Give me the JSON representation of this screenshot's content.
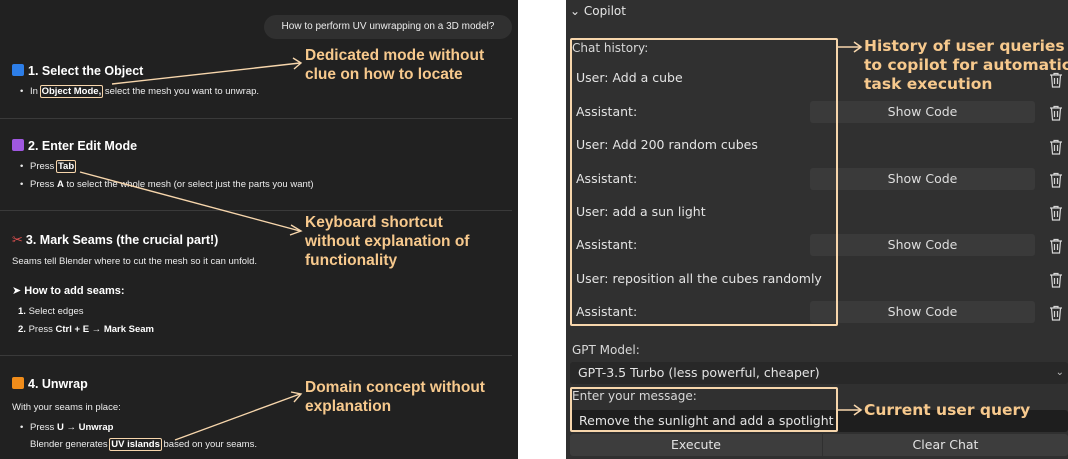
{
  "colors": {
    "annotation": "#f7c98d",
    "highlight_box": "#f7d6ac",
    "left_bg": "#212121",
    "right_bg": "#303030"
  },
  "left": {
    "user_question": "How to perform UV unwrapping on a 3D model?",
    "s1": {
      "icon": "blue-square-icon",
      "title": "1. Select the Object",
      "b1_pre": "In ",
      "b1_hl": "Object Mode,",
      "b1_post": " select the mesh you want to unwrap."
    },
    "s2": {
      "icon": "purple-square-icon",
      "title": "2. Enter Edit Mode",
      "b1_pre": "Press ",
      "b1_hl": "Tab",
      "b2_pre": "Press ",
      "b2_key": "A",
      "b2_post": " to select the whole mesh (or select just the parts you want)"
    },
    "s3": {
      "icon": "scissors-icon",
      "icon_glyph": "✂",
      "title": "3. Mark Seams (the crucial part!)",
      "desc": "Seams tell Blender where to cut the mesh so it can unfold.",
      "how_title": "➤ How to add seams:",
      "n1_num": "1.",
      "n1": "Select edges",
      "n2_num": "2.",
      "n2_pre": "Press ",
      "n2_key": "Ctrl + E → Mark Seam"
    },
    "s4": {
      "icon": "orange-square-icon",
      "title": "4. Unwrap",
      "desc": "With your seams in place:",
      "b1_pre": "Press ",
      "b1_key": "U → Unwrap",
      "b2_pre": "Blender generates ",
      "b2_hl": "UV islands",
      "b2_post": " based on your seams."
    },
    "annotations": {
      "a1_line1": "Dedicated mode without",
      "a1_line2": "clue on how to locate",
      "a2_line1": "Keyboard shortcut",
      "a2_line2": "without explanation of",
      "a2_line3": "functionality",
      "a3_line1": "Domain concept without",
      "a3_line2": "explanation"
    }
  },
  "right": {
    "panel_title": "Copilot",
    "chat_history_label": "Chat history:",
    "rows": [
      {
        "text": "User: Add a cube",
        "show_code": false
      },
      {
        "text": "Assistant:",
        "show_code": true
      },
      {
        "text": "User: Add 200 random cubes",
        "show_code": false
      },
      {
        "text": "Assistant:",
        "show_code": true
      },
      {
        "text": "User: add a sun light",
        "show_code": false
      },
      {
        "text": "Assistant:",
        "show_code": true
      },
      {
        "text": "User: reposition all the cubes randomly",
        "show_code": false
      },
      {
        "text": "Assistant:",
        "show_code": true
      }
    ],
    "show_code_label": "Show Code",
    "gpt_model_label": "GPT Model:",
    "gpt_model_value": "GPT-3.5 Turbo (less powerful, cheaper)",
    "message_label": "Enter your message:",
    "message_value": "Remove the sunlight and add a spotlight",
    "execute_label": "Execute",
    "clear_chat_label": "Clear Chat",
    "annotations": {
      "h1": "History of user queries",
      "h2": "to copilot for automatic",
      "h3": "task execution",
      "q1": "Current user query"
    }
  }
}
